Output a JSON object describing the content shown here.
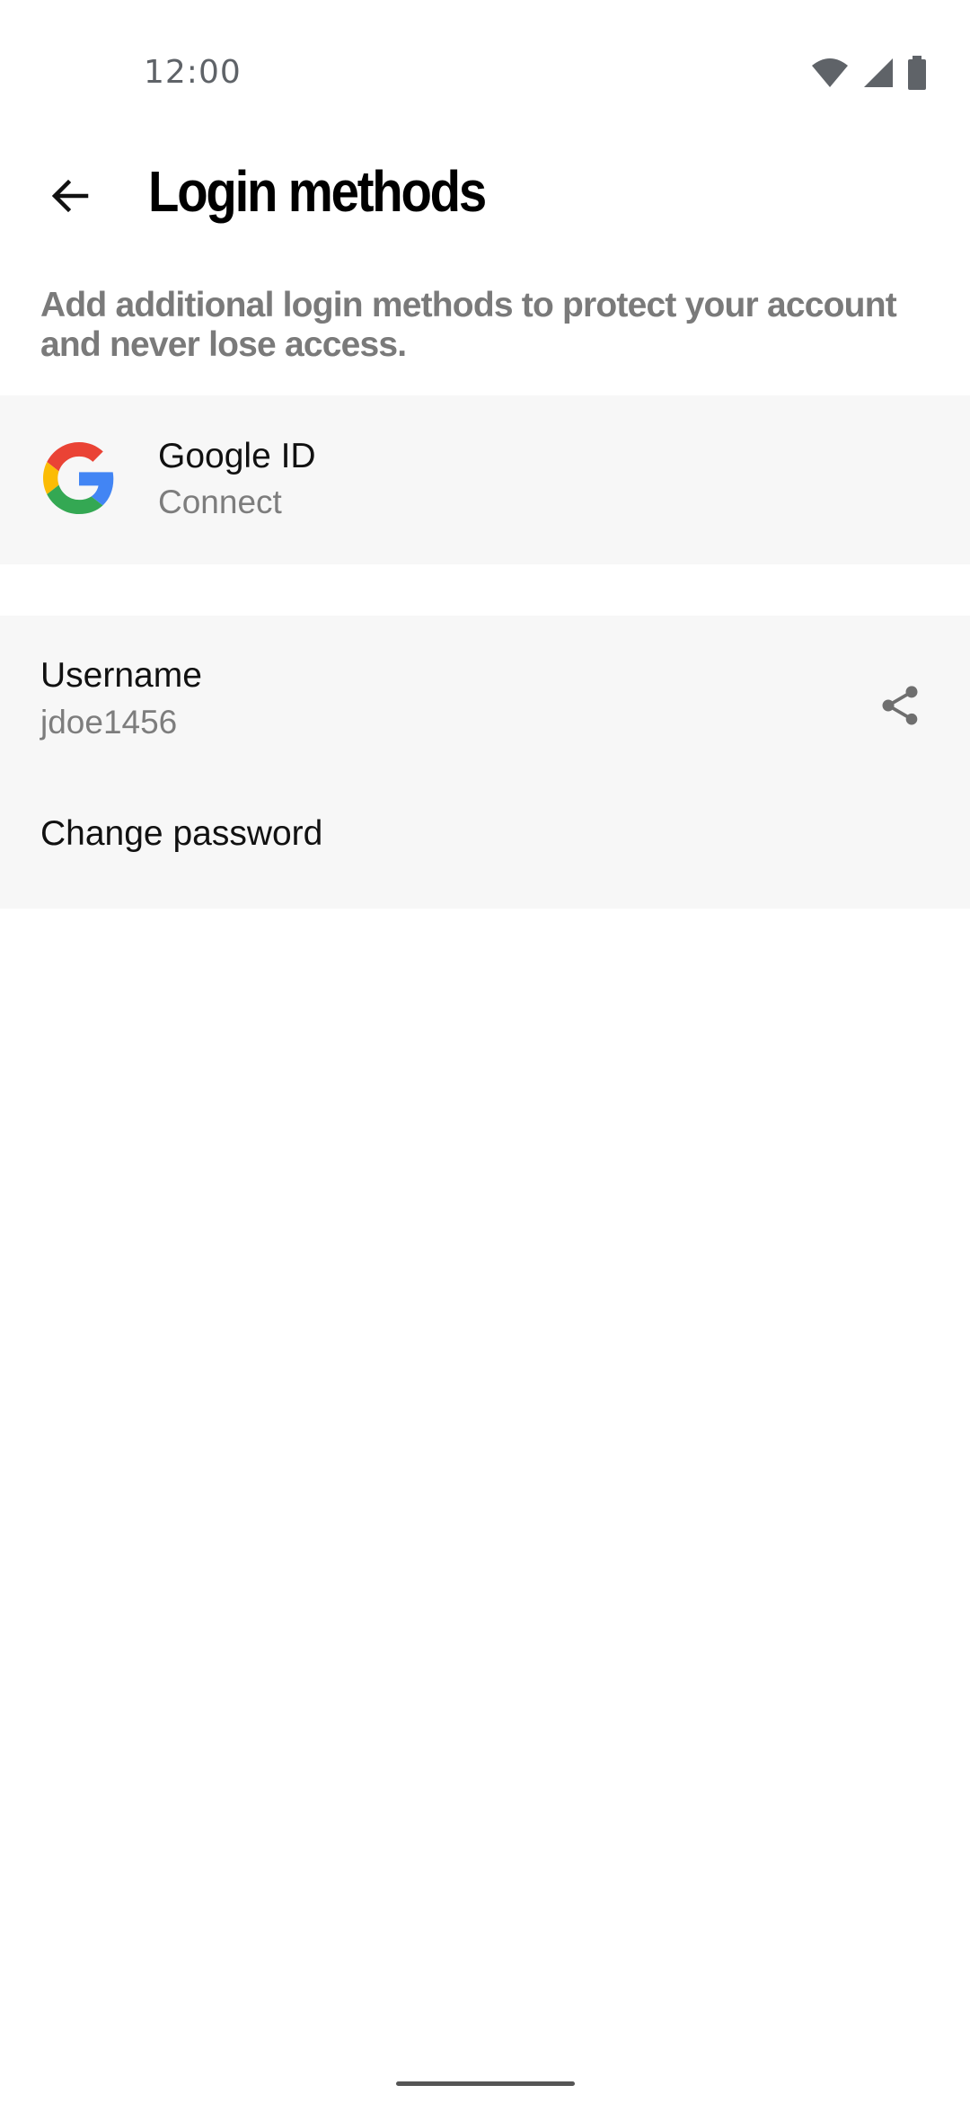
{
  "status_bar": {
    "time": "12:00",
    "icons": [
      "wifi-icon",
      "cellular-signal-icon",
      "battery-icon"
    ]
  },
  "header": {
    "title": "Login methods",
    "back_icon": "arrow-back-icon"
  },
  "description": "Add additional login methods to protect your account and never lose access.",
  "google": {
    "title": "Google ID",
    "action": "Connect",
    "icon": "google-logo-icon"
  },
  "account": {
    "username_label": "Username",
    "username_value": "jdoe1456",
    "share_icon": "share-icon",
    "change_password_label": "Change password"
  },
  "colors": {
    "card_background": "#f7f7f7",
    "secondary_text": "#7d7d7d",
    "google_red": "#EA4335",
    "google_yellow": "#FBBC05",
    "google_green": "#34A853",
    "google_blue": "#4285F4"
  }
}
